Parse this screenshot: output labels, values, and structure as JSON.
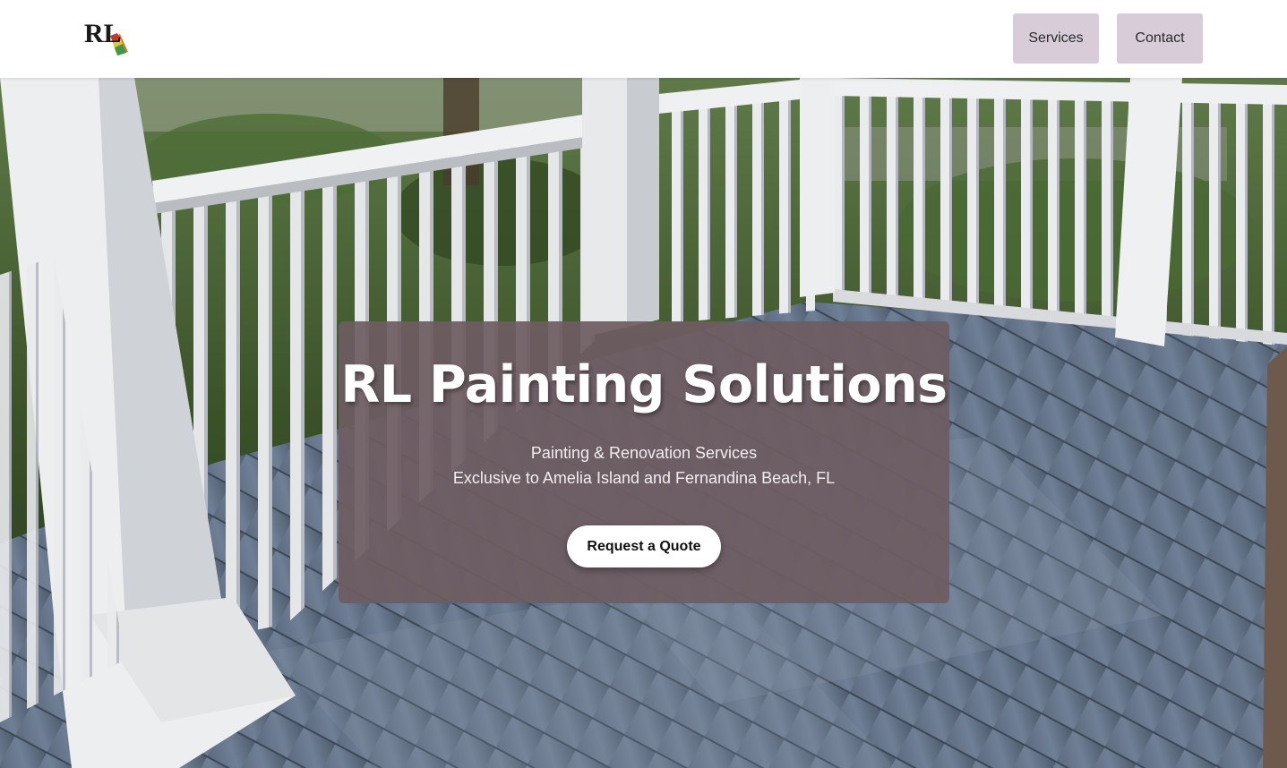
{
  "header": {
    "logo_text": "RL",
    "nav": {
      "services_label": "Services",
      "contact_label": "Contact"
    }
  },
  "hero": {
    "title": "RL Painting Solutions",
    "subtitle_line1": "Painting & Renovation Services",
    "subtitle_line2": "Exclusive to Amelia Island and Fernandina Beach, FL",
    "cta_label": "Request a Quote"
  },
  "colors": {
    "nav_button_bg": "#d8ccd9",
    "hero_card_bg": "#6e5c62",
    "cta_bg": "#ffffff"
  }
}
